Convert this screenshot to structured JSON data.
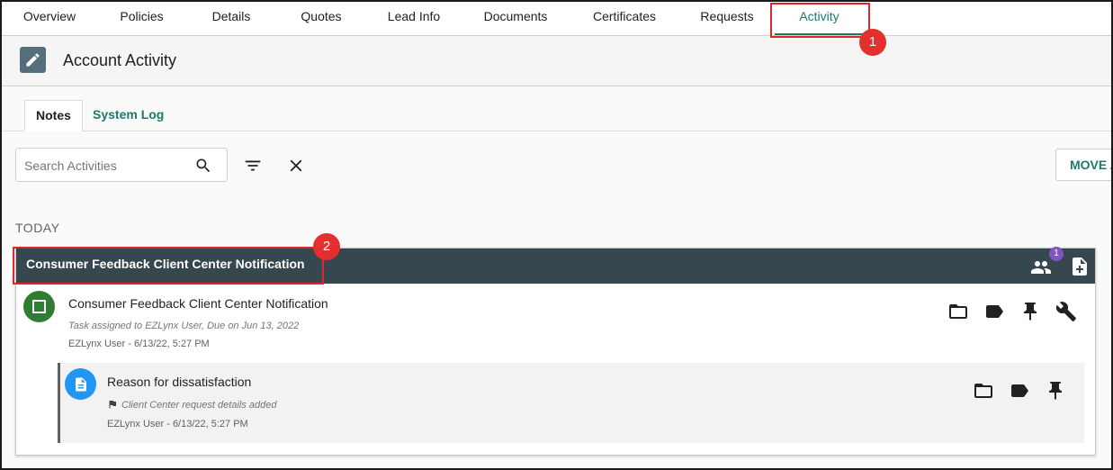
{
  "nav": {
    "tabs": [
      {
        "label": "Overview"
      },
      {
        "label": "Policies"
      },
      {
        "label": "Details"
      },
      {
        "label": "Quotes"
      },
      {
        "label": "Lead Info"
      },
      {
        "label": "Documents"
      },
      {
        "label": "Certificates"
      },
      {
        "label": "Requests"
      },
      {
        "label": "Activity"
      }
    ],
    "active_tab": "Activity"
  },
  "annotations": {
    "badge1": "1",
    "badge2": "2",
    "highlight_color": "#e0262a"
  },
  "header": {
    "title": "Account Activity",
    "icon": "edit-note-icon"
  },
  "subtabs": {
    "items": [
      {
        "label": "Notes"
      },
      {
        "label": "System Log"
      }
    ],
    "active": "Notes"
  },
  "toolbar": {
    "search_placeholder": "Search Activities",
    "move_label": "MOVE A"
  },
  "section": {
    "label": "TODAY"
  },
  "activity": {
    "title": "Consumer Feedback Client Center Notification",
    "participants_count": "1",
    "task": {
      "title": "Consumer Feedback Client Center Notification",
      "subtitle": "Task assigned to EZLynx User, Due on Jun 13, 2022",
      "meta": "EZLynx User - 6/13/22, 5:27 PM"
    },
    "note": {
      "title": "Reason for dissatisfaction",
      "subtitle": "Client Center request details added",
      "meta": "EZLynx User - 6/13/22, 5:27 PM"
    }
  },
  "colors": {
    "accent": "#1b7a6c",
    "card_header": "#37474f",
    "task_status": "#2e7d32",
    "note_icon": "#2196f3",
    "count_badge": "#7e57c2"
  }
}
